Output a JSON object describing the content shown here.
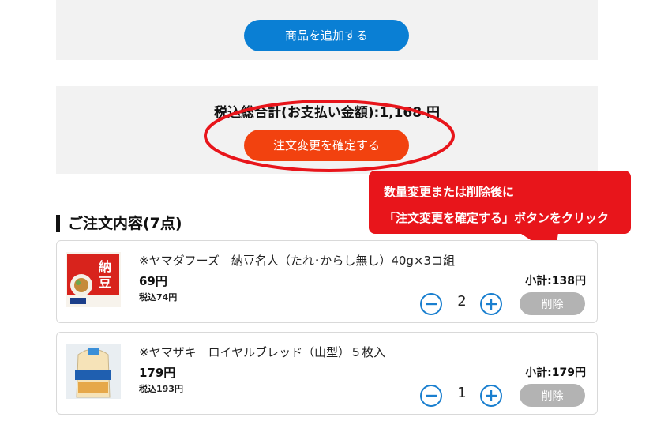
{
  "add_section": {
    "add_button_label": "商品を追加する"
  },
  "total_section": {
    "total_text": "税込総合計(お支払い金額):1,168 円",
    "confirm_button_label": "注文変更を確定する"
  },
  "callout": {
    "line1": "数量変更または削除後に",
    "line2": "「注文変更を確定する」ボタンをクリック",
    "color": "#e8151b"
  },
  "order": {
    "section_title": "ご注文内容(7点)",
    "items": [
      {
        "name": "※ヤマダフーズ　納豆名人（たれ･からし無し）40g×3コ組",
        "price": "69円",
        "tax_included": "税込74円",
        "subtotal": "小計:138円",
        "quantity": "2",
        "delete_label": "削除",
        "image_icon": "natto-package-image"
      },
      {
        "name": "※ヤマザキ　ロイヤルブレッド（山型）５枚入",
        "price": "179円",
        "tax_included": "税込193円",
        "subtotal": "小計:179円",
        "quantity": "1",
        "delete_label": "削除",
        "image_icon": "bread-package-image"
      }
    ]
  },
  "colors": {
    "blue": "#0a7fd4",
    "orange": "#f2420f",
    "red": "#e8151b",
    "gray_button": "#b3b3b3",
    "qty_icon": "#1a7fcf"
  }
}
